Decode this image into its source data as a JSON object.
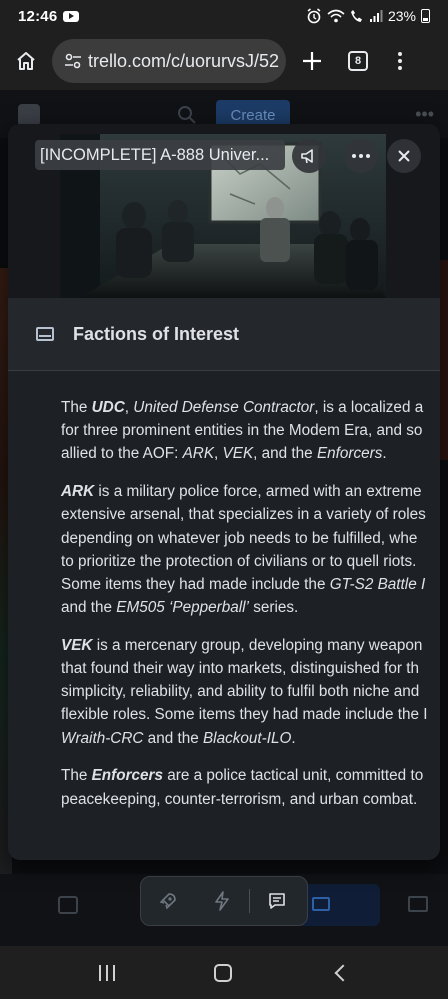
{
  "status_bar": {
    "time": "12:46",
    "battery": "23%"
  },
  "browser": {
    "url": "trello.com/c/uorurvsJ/52",
    "tab_count": "8"
  },
  "background_page": {
    "create_label": "Create"
  },
  "card": {
    "title": "[INCOMPLETE] A-888 Univer...",
    "section_title": "Factions of Interest",
    "description": [
      [
        [
          {
            "t": "The "
          },
          {
            "t": "UDC",
            "b": true,
            "i": true
          },
          {
            "t": ", "
          },
          {
            "t": "United Defense Contractor",
            "i": true
          },
          {
            "t": ", is a localized a"
          }
        ],
        [
          {
            "t": "for three prominent entities in the Modem Era, and so"
          }
        ],
        [
          {
            "t": "allied to the AOF: "
          },
          {
            "t": "ARK",
            "i": true
          },
          {
            "t": ", "
          },
          {
            "t": "VEK",
            "i": true
          },
          {
            "t": ", and the "
          },
          {
            "t": "Enforcers",
            "i": true
          },
          {
            "t": "."
          }
        ]
      ],
      [
        [
          {
            "t": "ARK",
            "b": true,
            "i": true
          },
          {
            "t": " is a military police force, armed with an extreme"
          }
        ],
        [
          {
            "t": "extensive arsenal, that specializes in a variety of roles"
          }
        ],
        [
          {
            "t": "depending on whatever job needs to be fulfilled, whe"
          }
        ],
        [
          {
            "t": "to prioritize the protection of civilians or to quell riots."
          }
        ],
        [
          {
            "t": "Some items they had made include the "
          },
          {
            "t": "GT-S2 Battle I",
            "i": true
          }
        ],
        [
          {
            "t": "and the "
          },
          {
            "t": "EM505 ‘Pepperball’",
            "i": true
          },
          {
            "t": " series."
          }
        ]
      ],
      [
        [
          {
            "t": "VEK",
            "b": true,
            "i": true
          },
          {
            "t": " is a mercenary group, developing many weapon"
          }
        ],
        [
          {
            "t": "that found their way into markets, distinguished for th"
          }
        ],
        [
          {
            "t": "simplicity, reliability, and ability to fulfil both niche and"
          }
        ],
        [
          {
            "t": "flexible roles. Some items they had made include the I"
          }
        ],
        [
          {
            "t": "Wraith-CRC",
            "i": true
          },
          {
            "t": " and the "
          },
          {
            "t": "Blackout-ILO",
            "i": true
          },
          {
            "t": "."
          }
        ]
      ],
      [
        [
          {
            "t": "The "
          },
          {
            "t": "Enforcers",
            "b": true,
            "i": true
          },
          {
            "t": " are a police tactical unit, committed to"
          }
        ],
        [
          {
            "t": "peacekeeping, counter-terrorism, and urban combat."
          }
        ]
      ]
    ]
  },
  "icons": {
    "home": "home-icon",
    "site_settings": "tune-icon",
    "new_tab": "plus-icon",
    "tabs": "tab-switcher-icon",
    "menu": "more-vert-icon",
    "cover": "cover-icon",
    "more": "more-horiz-icon",
    "close": "close-icon",
    "description": "description-icon",
    "power_ups": "rocket-icon",
    "automation": "lightning-icon",
    "comments": "comment-icon"
  },
  "colors": {
    "modal_bg": "#1d2125",
    "accent": "#579dff",
    "text": "#dfe1e6"
  }
}
